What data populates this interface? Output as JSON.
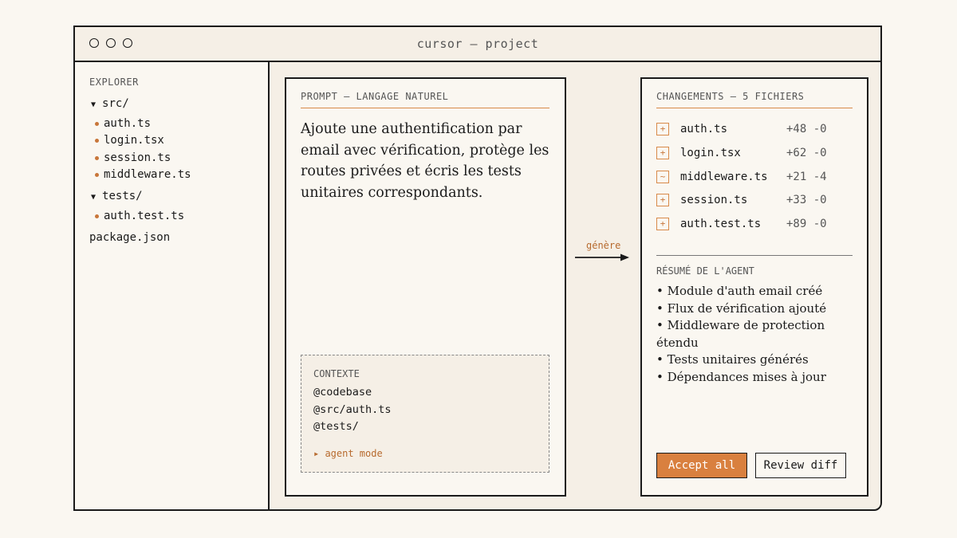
{
  "window": {
    "title": "cursor — project"
  },
  "explorer": {
    "label": "EXPLORER",
    "folders": [
      {
        "name": "src/"
      },
      {
        "name": "tests/"
      }
    ],
    "src_files": [
      "auth.ts",
      "login.tsx",
      "session.ts",
      "middleware.ts"
    ],
    "tests_files": [
      "auth.test.ts"
    ],
    "root_files": [
      "package.json"
    ]
  },
  "prompt": {
    "header": "PROMPT — LANGAGE NATUREL",
    "text": "Ajoute une authentification par email avec vérification, protège les routes privées et écris les tests unitaires correspondants.",
    "context": {
      "label": "CONTEXTE",
      "items": [
        "@codebase",
        "@src/auth.ts",
        "@tests/"
      ],
      "mode": "▸ agent mode"
    }
  },
  "arrow": {
    "label": "génère"
  },
  "changes": {
    "header": "CHANGEMENTS — 5 FICHIERS",
    "files": [
      {
        "icon": "+",
        "name": "auth.ts",
        "stats": "+48 -0"
      },
      {
        "icon": "+",
        "name": "login.tsx",
        "stats": "+62 -0"
      },
      {
        "icon": "~",
        "name": "middleware.ts",
        "stats": "+21 -4"
      },
      {
        "icon": "+",
        "name": "session.ts",
        "stats": "+33 -0"
      },
      {
        "icon": "+",
        "name": "auth.test.ts",
        "stats": "+89 -0"
      }
    ],
    "summary_label": "RÉSUMÉ DE L'AGENT",
    "summary": [
      "• Module d'auth email créé",
      "• Flux de vérification ajouté",
      "• Middleware de protection étendu",
      "• Tests unitaires générés",
      "• Dépendances mises à jour"
    ],
    "accept_label": "Accept all",
    "review_label": "Review diff"
  },
  "colors": {
    "accent": "#d9803f",
    "background": "#f5efe6",
    "border": "#1a1a1a"
  },
  "icons": {
    "window_controls": "circle-icon",
    "folder_caret": "caret-down-icon",
    "added_file": "plus-icon",
    "modified_file": "tilde-icon",
    "arrow": "arrow-right-icon"
  }
}
